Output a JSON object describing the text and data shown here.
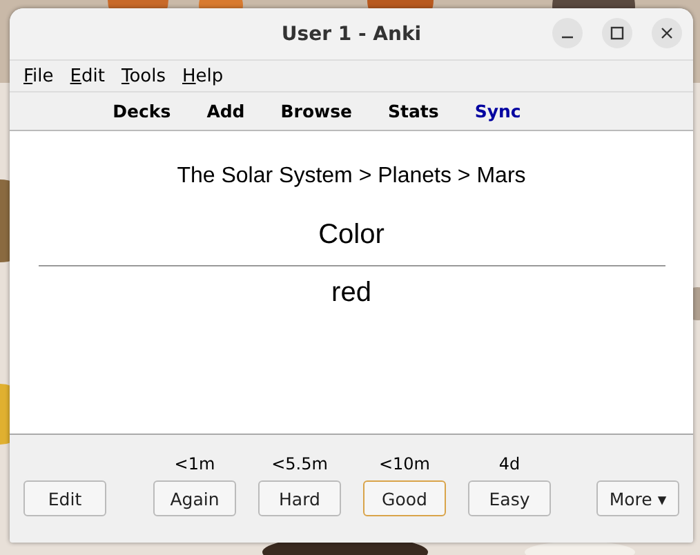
{
  "window": {
    "title": "User 1 - Anki"
  },
  "menu": [
    {
      "label": "File"
    },
    {
      "label": "Edit"
    },
    {
      "label": "Tools"
    },
    {
      "label": "Help"
    }
  ],
  "toolbar": [
    {
      "label": "Decks",
      "color": "#000000"
    },
    {
      "label": "Add",
      "color": "#000000"
    },
    {
      "label": "Browse",
      "color": "#000000"
    },
    {
      "label": "Stats",
      "color": "#000000"
    },
    {
      "label": "Sync",
      "color": "#0000a0"
    }
  ],
  "card": {
    "breadcrumb": "The Solar System > Planets > Mars",
    "question": "Color",
    "answer": "red"
  },
  "edit_button": "Edit",
  "answer_buttons": [
    {
      "label": "Again",
      "interval": "<1m",
      "focused": false
    },
    {
      "label": "Hard",
      "interval": "<5.5m",
      "focused": false
    },
    {
      "label": "Good",
      "interval": "<10m",
      "focused": true
    },
    {
      "label": "Easy",
      "interval": "4d",
      "focused": false
    }
  ],
  "more_button": {
    "label": "More",
    "arrow": "▾"
  }
}
